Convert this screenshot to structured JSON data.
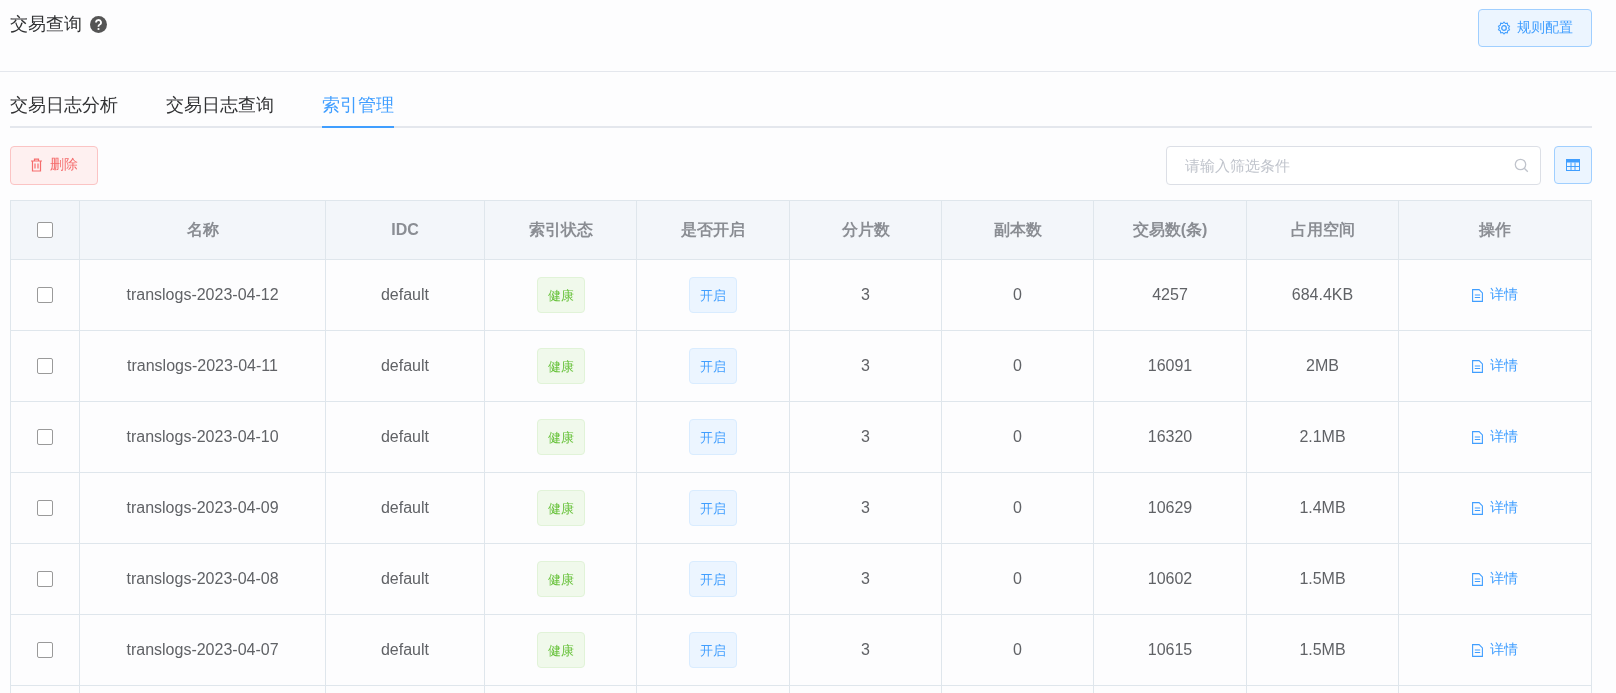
{
  "header": {
    "title": "交易查询",
    "config_button": "规则配置"
  },
  "tabs": [
    {
      "label": "交易日志分析",
      "selected": false
    },
    {
      "label": "交易日志查询",
      "selected": false
    },
    {
      "label": "索引管理",
      "selected": true
    }
  ],
  "toolbar": {
    "delete_button": "删除",
    "search": {
      "placeholder": "请输入筛选条件"
    }
  },
  "table": {
    "select_all": false,
    "columns": [
      "名称",
      "IDC",
      "索引状态",
      "是否开启",
      "分片数",
      "副本数",
      "交易数(条)",
      "占用空间",
      "操作"
    ],
    "rows": [
      {
        "checked": false,
        "name": "translogs-2023-04-12",
        "idc": "default",
        "status": "健康",
        "enabled": "开启",
        "shards": "3",
        "replicas": "0",
        "transactions": "4257",
        "size": "684.4KB",
        "action": "详情"
      },
      {
        "checked": false,
        "name": "translogs-2023-04-11",
        "idc": "default",
        "status": "健康",
        "enabled": "开启",
        "shards": "3",
        "replicas": "0",
        "transactions": "16091",
        "size": "2MB",
        "action": "详情"
      },
      {
        "checked": false,
        "name": "translogs-2023-04-10",
        "idc": "default",
        "status": "健康",
        "enabled": "开启",
        "shards": "3",
        "replicas": "0",
        "transactions": "16320",
        "size": "2.1MB",
        "action": "详情"
      },
      {
        "checked": false,
        "name": "translogs-2023-04-09",
        "idc": "default",
        "status": "健康",
        "enabled": "开启",
        "shards": "3",
        "replicas": "0",
        "transactions": "10629",
        "size": "1.4MB",
        "action": "详情"
      },
      {
        "checked": false,
        "name": "translogs-2023-04-08",
        "idc": "default",
        "status": "健康",
        "enabled": "开启",
        "shards": "3",
        "replicas": "0",
        "transactions": "10602",
        "size": "1.5MB",
        "action": "详情"
      },
      {
        "checked": false,
        "name": "translogs-2023-04-07",
        "idc": "default",
        "status": "健康",
        "enabled": "开启",
        "shards": "3",
        "replicas": "0",
        "transactions": "10615",
        "size": "1.5MB",
        "action": "详情"
      }
    ]
  }
}
